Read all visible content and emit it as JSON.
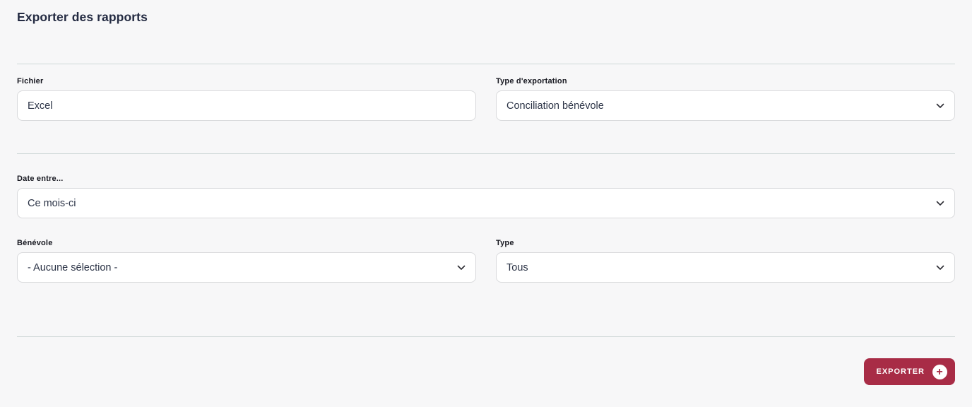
{
  "page": {
    "title": "Exporter des rapports"
  },
  "form": {
    "fichier": {
      "label": "Fichier",
      "value": "Excel"
    },
    "type_exportation": {
      "label": "Type d'exportation",
      "value": "Conciliation bénévole"
    },
    "date_entre": {
      "label": "Date entre...",
      "value": "Ce mois-ci"
    },
    "benevole": {
      "label": "Bénévole",
      "value": "- Aucune sélection -"
    },
    "type": {
      "label": "Type",
      "value": "Tous"
    }
  },
  "actions": {
    "export_label": "EXPORTER",
    "plus_icon": "+"
  },
  "icons": {
    "chevron_down": "chevron-down",
    "export_plus": "plus-in-circle"
  },
  "colors": {
    "accent": "#a82c46",
    "background": "#f7f7f8",
    "divider": "#cfd8d7",
    "field_border": "#d9dadc",
    "title_text": "#242b42",
    "field_text": "#2b3346"
  }
}
